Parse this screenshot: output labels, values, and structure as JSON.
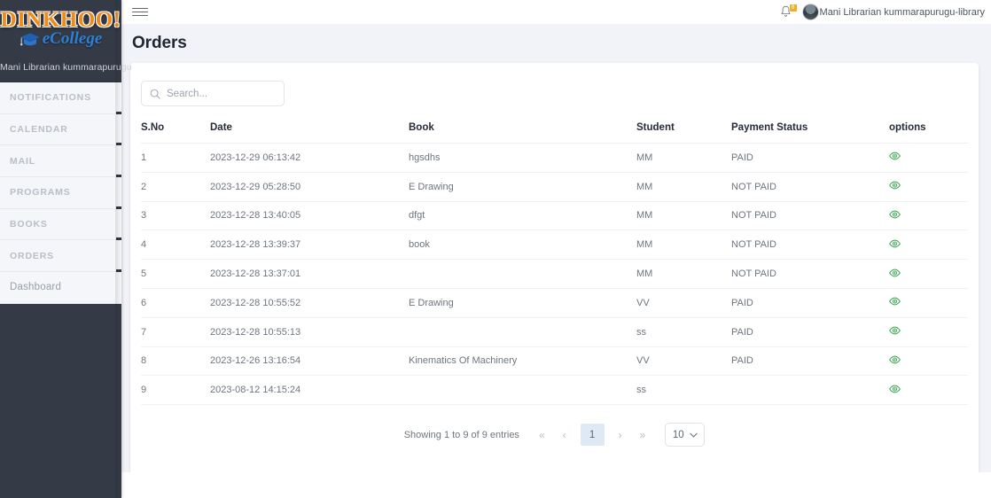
{
  "sidebar": {
    "logo_primary": "DINKHOO!",
    "logo_secondary": "eCollege",
    "user_label": "Mani Librarian kummarapurugu",
    "items": [
      {
        "label": "NOTIFICATIONS"
      },
      {
        "label": "CALENDAR"
      },
      {
        "label": "MAIL"
      },
      {
        "label": "PROGRAMS"
      },
      {
        "label": "BOOKS"
      },
      {
        "label": "ORDERS"
      },
      {
        "label": "Dashboard"
      }
    ]
  },
  "topbar": {
    "menu_icon": "hamburger-icon",
    "notification_icon": "bell-icon",
    "notification_count": "0",
    "user_name": "Mani Librarian kummarapurugu-library"
  },
  "page": {
    "title": "Orders"
  },
  "search": {
    "placeholder": "Search...",
    "value": "",
    "icon": "search-icon"
  },
  "table": {
    "columns": [
      "S.No",
      "Date",
      "Book",
      "Student",
      "Payment Status",
      "options"
    ],
    "row_action_icon": "eye-icon",
    "row_action_color": "#2e9e46",
    "rows": [
      {
        "sno": "1",
        "date": "2023-12-29 06:13:42",
        "book": "hgsdhs",
        "student": "MM",
        "payment": "PAID"
      },
      {
        "sno": "2",
        "date": "2023-12-29 05:28:50",
        "book": "E Drawing",
        "student": "MM",
        "payment": "NOT PAID"
      },
      {
        "sno": "3",
        "date": "2023-12-28 13:40:05",
        "book": "dfgt",
        "student": "MM",
        "payment": "NOT PAID"
      },
      {
        "sno": "4",
        "date": "2023-12-28 13:39:37",
        "book": "book",
        "student": "MM",
        "payment": "NOT PAID"
      },
      {
        "sno": "5",
        "date": "2023-12-28 13:37:01",
        "book": "",
        "student": "MM",
        "payment": "NOT PAID"
      },
      {
        "sno": "6",
        "date": "2023-12-28 10:55:52",
        "book": "E Drawing",
        "student": "VV",
        "payment": "PAID"
      },
      {
        "sno": "7",
        "date": "2023-12-28 10:55:13",
        "book": "",
        "student": "ss",
        "payment": "PAID"
      },
      {
        "sno": "8",
        "date": "2023-12-26 13:16:54",
        "book": "Kinematics Of Machinery",
        "student": "VV",
        "payment": "PAID"
      },
      {
        "sno": "9",
        "date": "2023-08-12 14:15:24",
        "book": "",
        "student": "ss",
        "payment": ""
      }
    ]
  },
  "pagination": {
    "info": "Showing 1 to 9 of 9 entries",
    "first_label": "«",
    "prev_label": "‹",
    "current_page": "1",
    "next_label": "›",
    "last_label": "»",
    "page_size": "10"
  },
  "colors": {
    "sidebar_bg": "#343b47",
    "accent_orange": "#f08a1c",
    "accent_blue": "#2f7fd6",
    "badge": "#f0ad20",
    "page_bg": "#f1f3f8",
    "active_page": "#dfe9f5"
  }
}
